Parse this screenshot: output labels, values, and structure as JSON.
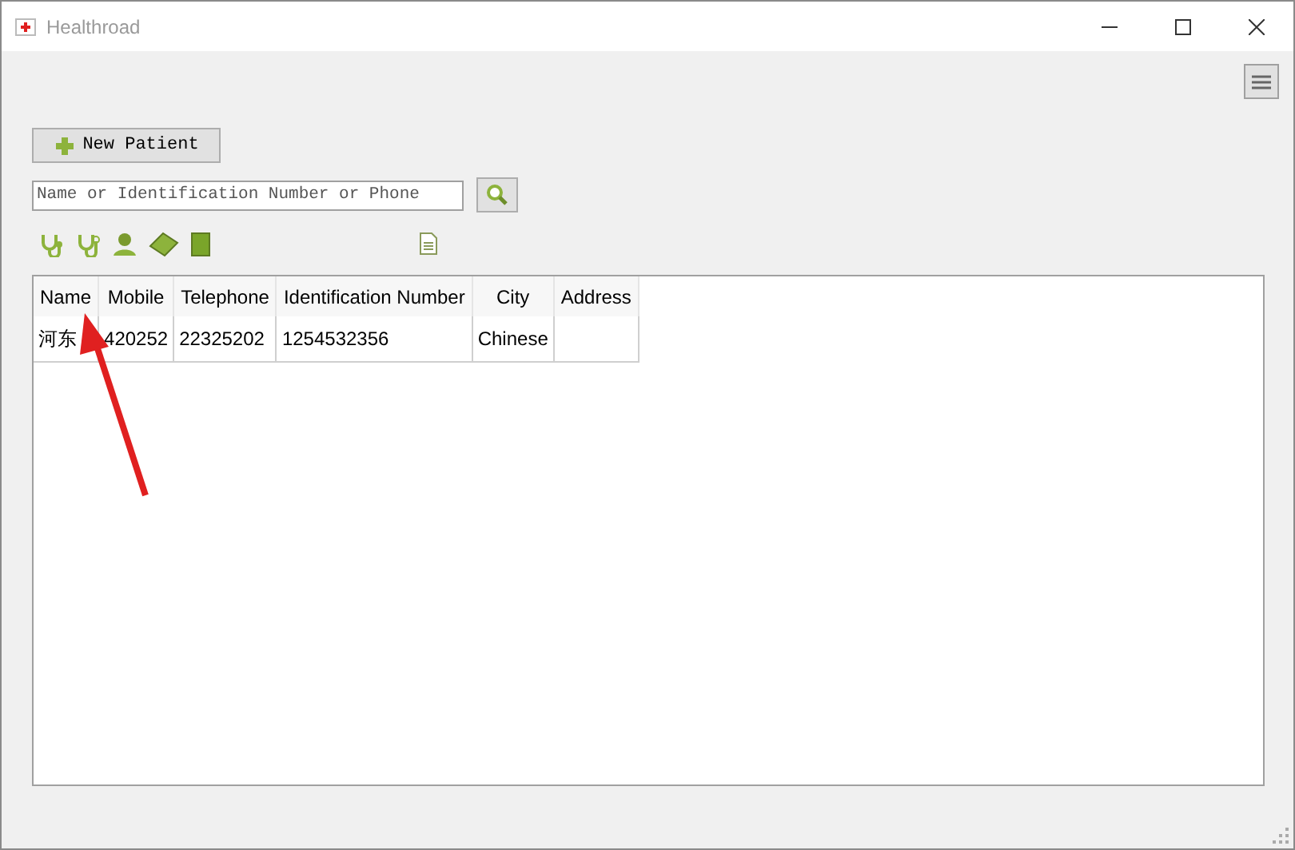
{
  "window": {
    "title": "Healthroad"
  },
  "new_patient_button": {
    "label": "New Patient"
  },
  "search": {
    "placeholder": "Name or Identification Number or Phone"
  },
  "table": {
    "columns": [
      "Name",
      "Mobile",
      "Telephone",
      "Identification Number",
      "City",
      "Address"
    ],
    "rows": [
      [
        "河东",
        "420252",
        "22325202",
        "1254532356",
        "Chinese",
        ""
      ]
    ]
  }
}
